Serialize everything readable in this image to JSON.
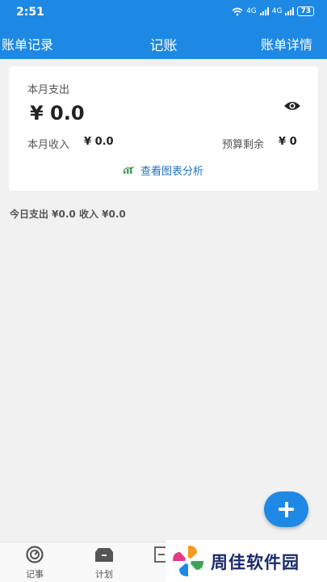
{
  "status_bar": {
    "time": "2:51",
    "network_1": "4G",
    "network_2": "4G",
    "battery": "73"
  },
  "header": {
    "left_link": "账单记录",
    "title": "记账",
    "right_link": "账单详情"
  },
  "summary": {
    "expense_label": "本月支出",
    "expense_value": "¥ 0.0",
    "income_label": "本月收入",
    "income_value": "¥ 0.0",
    "budget_label": "预算剩余",
    "budget_value": "¥ 0",
    "chart_link": "查看图表分析"
  },
  "today": {
    "text": "今日支出 ¥0.0 收入 ¥0.0"
  },
  "bottom_nav": {
    "tabs": [
      {
        "label": "记事",
        "icon": "timer-icon"
      },
      {
        "label": "计划",
        "icon": "folder-icon"
      },
      {
        "label": "",
        "icon": "list-icon"
      }
    ]
  },
  "watermark": {
    "text": "周佳软件园"
  },
  "colors": {
    "primary": "#1e88e5",
    "link": "#1e73c6",
    "background": "#f1f1f1"
  }
}
